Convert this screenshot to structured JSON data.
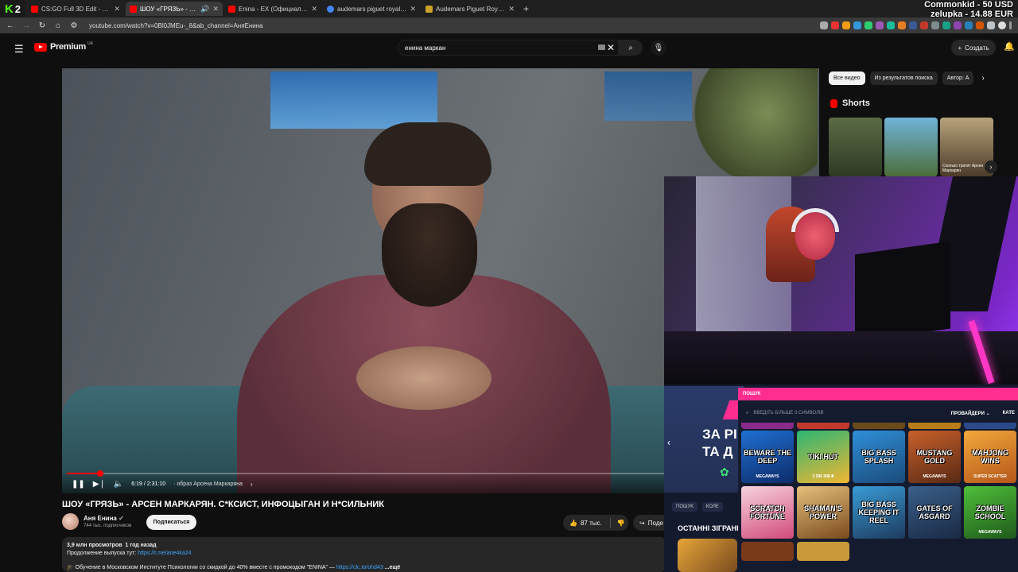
{
  "browser": {
    "k_badge": "2",
    "tabs": [
      {
        "title": "CS:GO Full 3D Edit - You Made",
        "color": "#ff0000"
      },
      {
        "title": "ШОУ «ГРЯЗЬ» - АРСЕН МАРКАРЯН",
        "color": "#ff0000"
      },
      {
        "title": "Enina - EX (Официальная пре...",
        "color": "#ff0000"
      },
      {
        "title": "audemars piguet royal oak gold",
        "color": "#4285f4"
      },
      {
        "title": "Audemars Piguet Royal Oak 15",
        "color": "#c9a227"
      }
    ],
    "url": "youtube.com/watch?v=0Bl0JMEu-_8&ab_channel=АняЕнина"
  },
  "donation": {
    "line1": "Commonkid - 50 USD",
    "line2": "zelupka - 14.88 EUR"
  },
  "header": {
    "logo_text": "Premium",
    "region": "UA",
    "search_value": "енина маркан",
    "create_label": "Создать"
  },
  "player": {
    "progress": 0.045,
    "time": "6:19 / 2:31:10",
    "chapter": "· образ Арсена Маркаряна"
  },
  "video": {
    "title": "ШОУ «ГРЯЗЬ» - АРСЕН МАРКАРЯН. С*КСИСТ, ИНФОЦЫГАН И Н*СИЛЬНИК",
    "channel": "Аня Енина",
    "subscribers": "744 тыс. подписчиков",
    "subscribe_label": "Подписаться",
    "likes": "87 тыс.",
    "share_label": "Поде",
    "views": "3,9 млн просмотров",
    "age": "1 год назад",
    "desc_line1": "Продолжение выпуска тут:",
    "desc_link1": "https://t.me/ane4ka24",
    "desc_line2": "🎓 Обучение в Московском Институте Психологии со скидкой до 40% вместе с промокодом \"ENINA\" —",
    "desc_link2": "https://clc.to/ohd43",
    "desc_more": "...ещё"
  },
  "sidebar": {
    "chips": [
      "Все видео",
      "Из результатов поиска",
      "Автор: А"
    ],
    "shorts_title": "Shorts",
    "shorts": [
      {
        "caption": "",
        "color1": "#5b6b45",
        "color2": "#2f3a25"
      },
      {
        "caption": "",
        "color1": "#6fb4d8",
        "color2": "#4c6e3a"
      },
      {
        "caption": "Сколько тратит Арсен Маркарян",
        "color1": "#b7a27a",
        "color2": "#4c3b2a"
      }
    ]
  },
  "casino": {
    "banner_text": "ЗА РІ ТА Д",
    "tabs": [
      "ПОШУК",
      "КОЛЕ"
    ],
    "last_played": "ОСТАННІ ЗІГРАНІ",
    "modal_title": "ПОШУК",
    "search_placeholder": "ВВЕДІТЬ БІЛЬШЕ 3 СИМВОЛІВ",
    "providers_label": "ПРОВАЙДЕРИ",
    "categories_label": "КАТЕ",
    "top_strip": [
      "#8a2a8a",
      "#c0392b",
      "#6b4a1a",
      "#b87d1a",
      "#2a4a8a"
    ],
    "games": [
      {
        "name": "BEWARE THE DEEP",
        "sub": "MEGAWAYS",
        "color1": "#1f6fd1",
        "color2": "#0d2c6b"
      },
      {
        "name": "TIKI HUT",
        "sub": "3 586 908 ₴",
        "color1": "#2bb673",
        "color2": "#f2b632"
      },
      {
        "name": "BIG BASS SPLASH",
        "sub": "",
        "color1": "#2f8fd8",
        "color2": "#1a4b7a"
      },
      {
        "name": "MUSTANG GOLD",
        "sub": "MEGAWAYS",
        "color1": "#c7602a",
        "color2": "#5a2a15"
      },
      {
        "name": "MAHJONG WINS",
        "sub": "SUPER SCATTER",
        "color1": "#f2a93b",
        "color2": "#b5561a"
      },
      {
        "name": "SCRATCH FORTUNE",
        "sub": "",
        "color1": "#f7d3de",
        "color2": "#d14a7a"
      },
      {
        "name": "SHAMAN'S POWER",
        "sub": "",
        "color1": "#e5c07b",
        "color2": "#7a4a1d"
      },
      {
        "name": "BIG BASS KEEPING IT REEL",
        "sub": "",
        "color1": "#3a9bd6",
        "color2": "#1c3b5e"
      },
      {
        "name": "GATES OF ASGARD",
        "sub": "",
        "color1": "#3a5f8a",
        "color2": "#1a2a44"
      },
      {
        "name": "ZOMBIE SCHOOL",
        "sub": "MEGAWAYS",
        "color1": "#4fbf3a",
        "color2": "#1f5a1a"
      }
    ],
    "bottom_row": [
      "#7a3a1a",
      "#c89a3a"
    ]
  }
}
